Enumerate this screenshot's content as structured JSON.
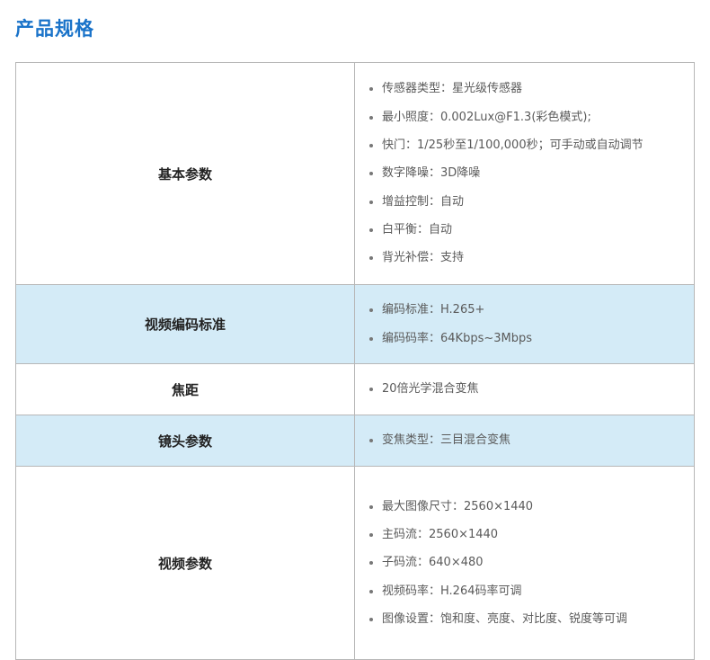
{
  "title": "产品规格",
  "rows": [
    {
      "label": "基本参数",
      "shaded": false,
      "items": [
        "传感器类型：星光级传感器",
        "最小照度：0.002Lux@F1.3(彩色模式);",
        "快门：1/25秒至1/100,000秒；可手动或自动调节",
        "数字降噪：3D降噪",
        "增益控制：自动",
        "白平衡：自动",
        "背光补偿：支持"
      ]
    },
    {
      "label": "视频编码标准",
      "shaded": true,
      "items": [
        "编码标准：H.265+",
        "编码码率：64Kbps~3Mbps"
      ]
    },
    {
      "label": "焦距",
      "shaded": false,
      "items": [
        "20倍光学混合变焦"
      ]
    },
    {
      "label": "镜头参数",
      "shaded": true,
      "items": [
        "变焦类型：三目混合变焦"
      ]
    },
    {
      "label": "视频参数",
      "shaded": false,
      "items": [
        "最大图像尺寸：2560×1440",
        "主码流：2560×1440",
        "子码流：640×480",
        "视频码率：H.264码率可调",
        "图像设置：饱和度、亮度、对比度、锐度等可调"
      ]
    }
  ]
}
